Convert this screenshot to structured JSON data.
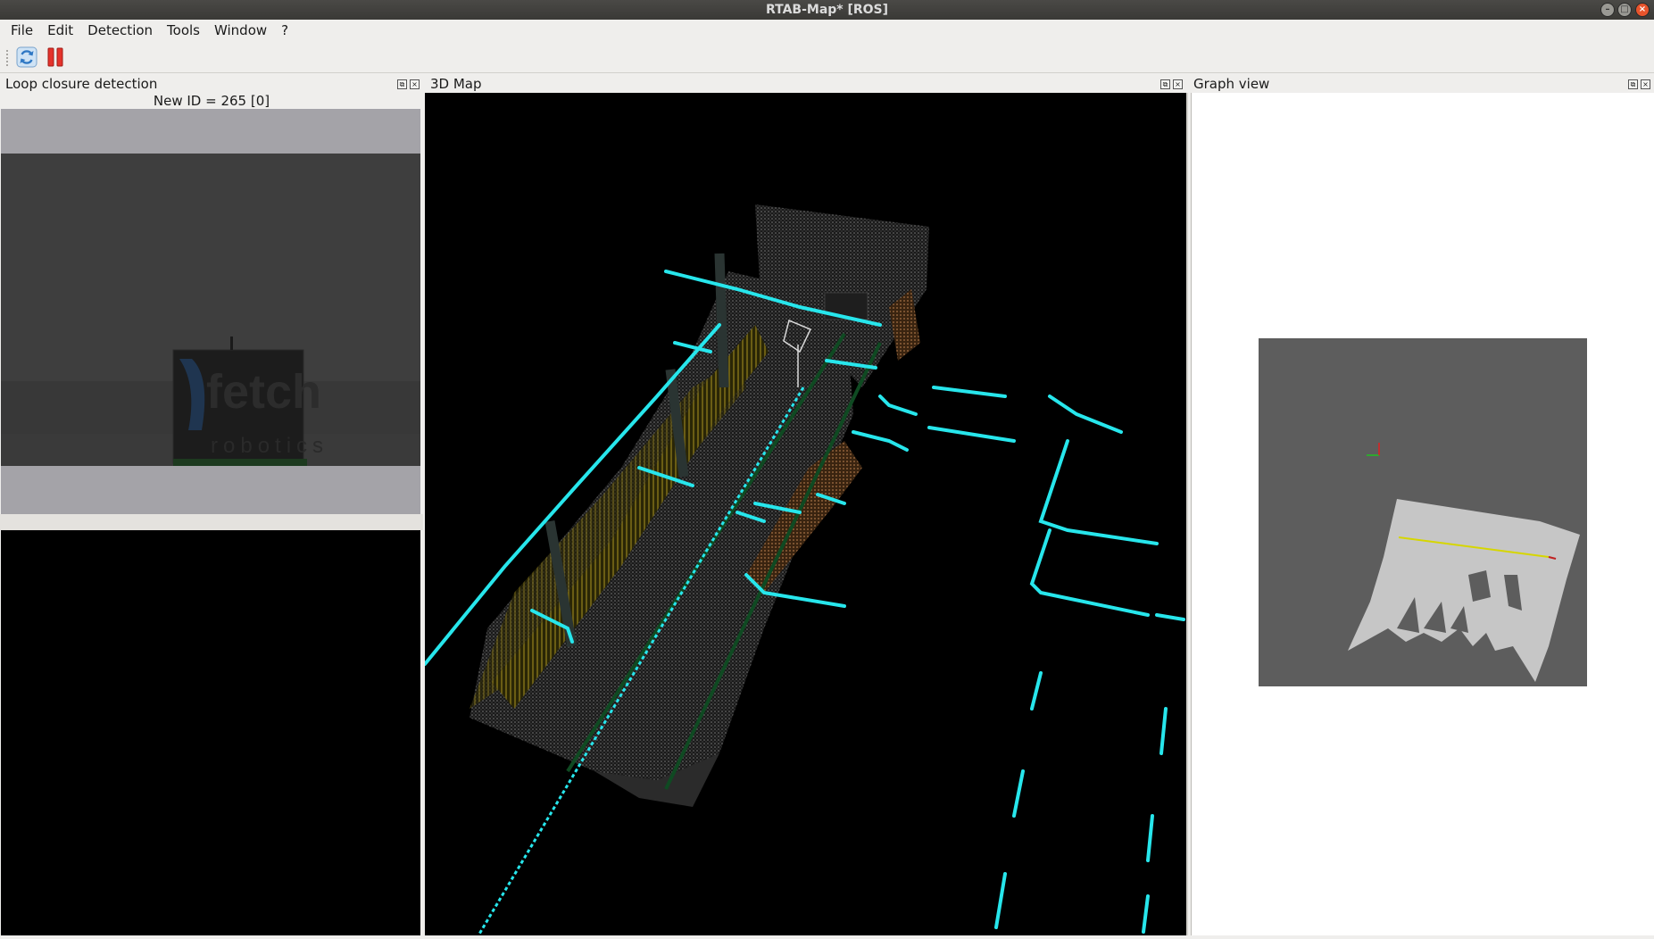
{
  "window": {
    "title": "RTAB-Map* [ROS]"
  },
  "menu": {
    "items": [
      "File",
      "Edit",
      "Detection",
      "Tools",
      "Window",
      "?"
    ]
  },
  "toolbar": {
    "refresh_icon": "refresh-icon",
    "pause_icon": "pause-icon"
  },
  "loop_panel": {
    "title": "Loop closure detection",
    "new_id_text": "New ID = 265 [0]"
  },
  "map_panel": {
    "title": "3D Map"
  },
  "graph_panel": {
    "title": "Graph view"
  },
  "colors": {
    "accent_cyan": "#27e6ec",
    "close_button": "#e8542c",
    "pause_red": "#e5322b"
  }
}
